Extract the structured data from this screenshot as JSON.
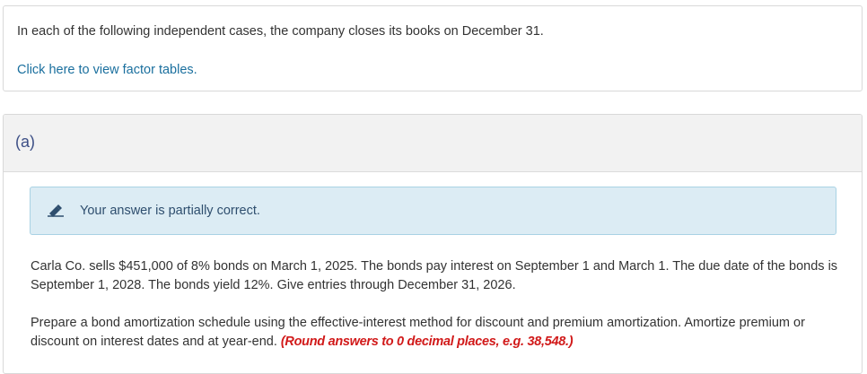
{
  "intro": {
    "text": "In each of the following independent cases, the company closes its books on December 31.",
    "factor_link": "Click here to view factor tables."
  },
  "part": {
    "label": "(a)",
    "feedback": {
      "icon": "pencil-icon",
      "text": "Your answer is partially correct."
    },
    "problem_text": "Carla Co. sells $451,000 of 8% bonds on March 1, 2025. The bonds pay interest on September 1 and March 1. The due date of the bonds is September 1, 2028. The bonds yield 12%. Give entries through December 31, 2026.",
    "instructions_text": "Prepare a bond amortization schedule using the effective-interest method for discount and premium amortization. Amortize premium or discount on interest dates and at year-end.",
    "round_note": "(Round answers to 0 decimal places, e.g. 38,548.)"
  },
  "colors": {
    "link": "#1a6f9e",
    "part_label": "#3d4f86",
    "feedback_bg": "#dcecf4",
    "feedback_border": "#a9d2e4",
    "round_note": "#d11a1a"
  }
}
